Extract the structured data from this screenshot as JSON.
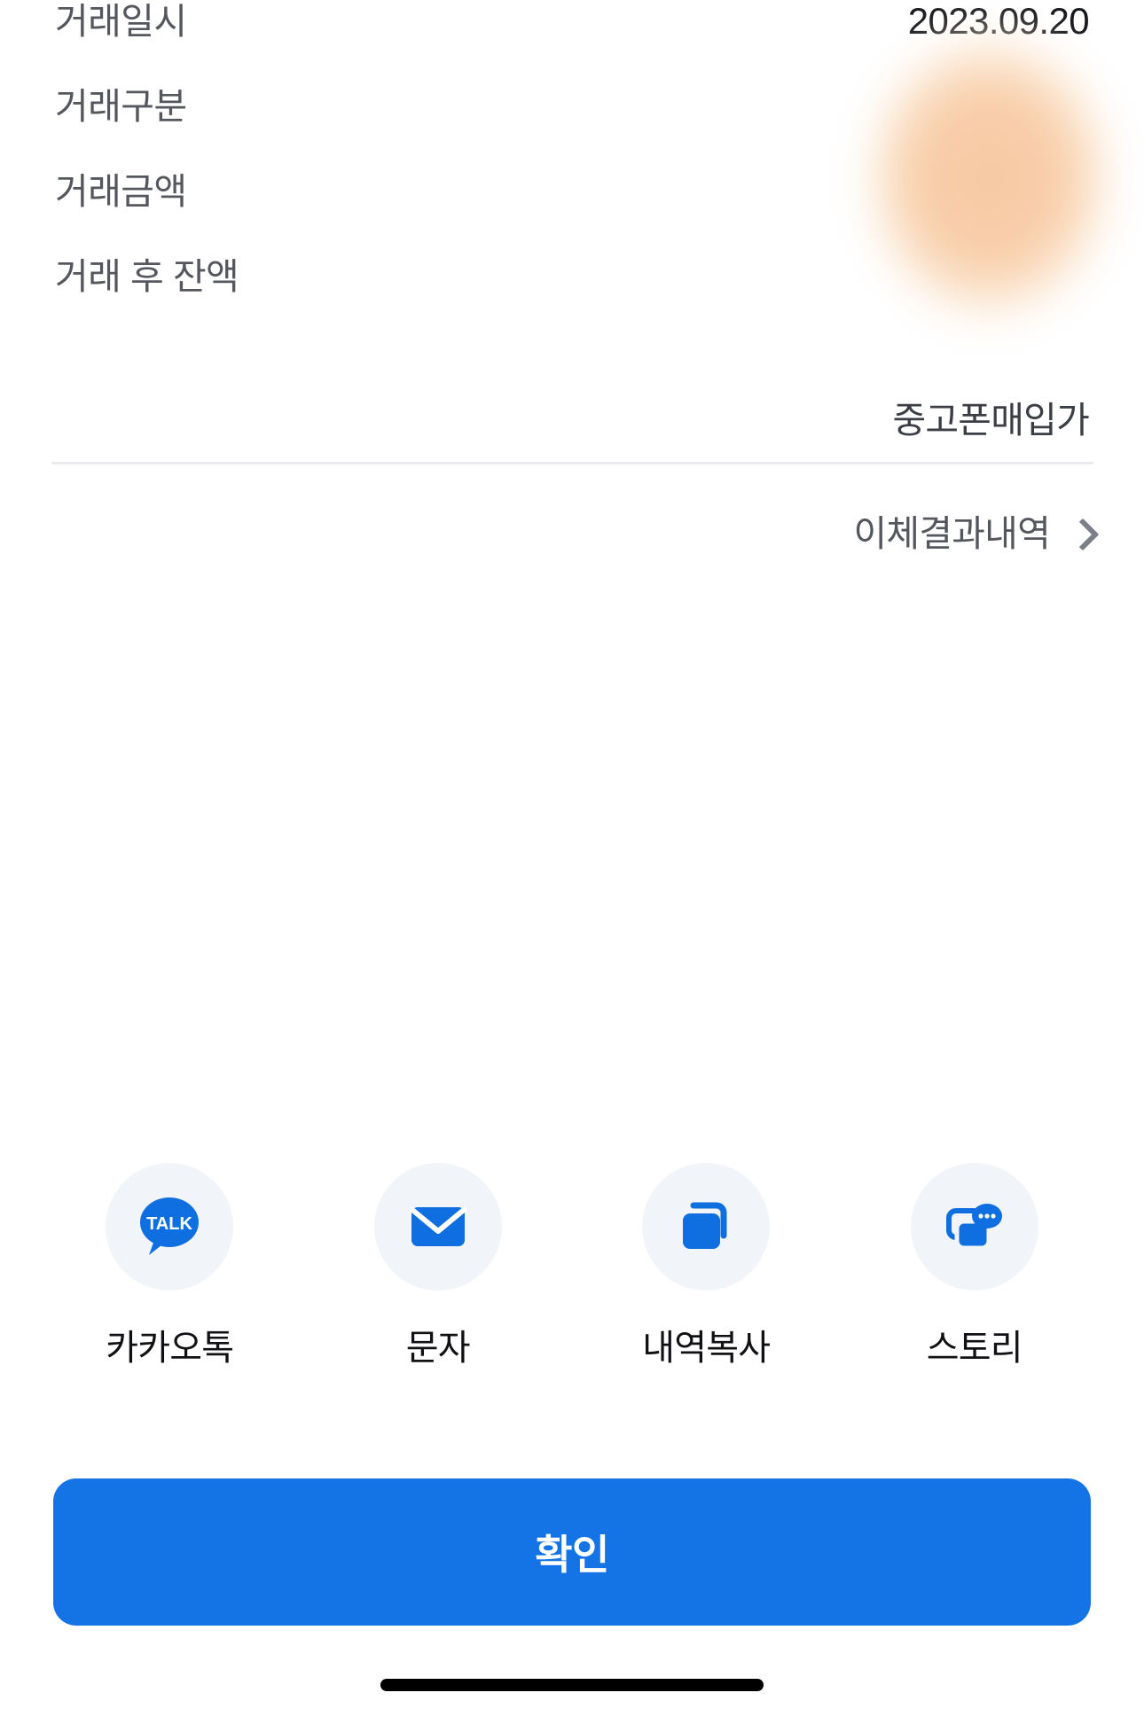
{
  "theme": {
    "accent_blue": "#1574e5",
    "icon_blue": "#0f6fe0",
    "icon_circle_bg": "#f1f4f9",
    "label_gray": "#55575e",
    "value_dark": "#16181d",
    "divider_gray": "#e9ebef",
    "blur_skin": "#f7c9a3"
  },
  "details": {
    "rows": [
      {
        "label": "거래일시",
        "value": "2023.09.20",
        "masked": false
      },
      {
        "label": "거래구분",
        "value": "",
        "masked": true
      },
      {
        "label": "거래금액",
        "value": "",
        "masked": true
      },
      {
        "label": "거래 후 잔액",
        "value": "",
        "masked": true
      }
    ]
  },
  "memo": {
    "text": "중고폰매입가"
  },
  "link": {
    "text": "이체결과내역",
    "chevron": "chevron-right-icon"
  },
  "share": {
    "items": [
      {
        "label": "카카오톡",
        "icon": "kakaotalk-icon",
        "badge": "TALK"
      },
      {
        "label": "문자",
        "icon": "envelope-icon",
        "badge": ""
      },
      {
        "label": "내역복사",
        "icon": "copy-icon",
        "badge": ""
      },
      {
        "label": "스토리",
        "icon": "story-chat-icon",
        "badge": ""
      }
    ]
  },
  "footer": {
    "confirm_label": "확인"
  }
}
